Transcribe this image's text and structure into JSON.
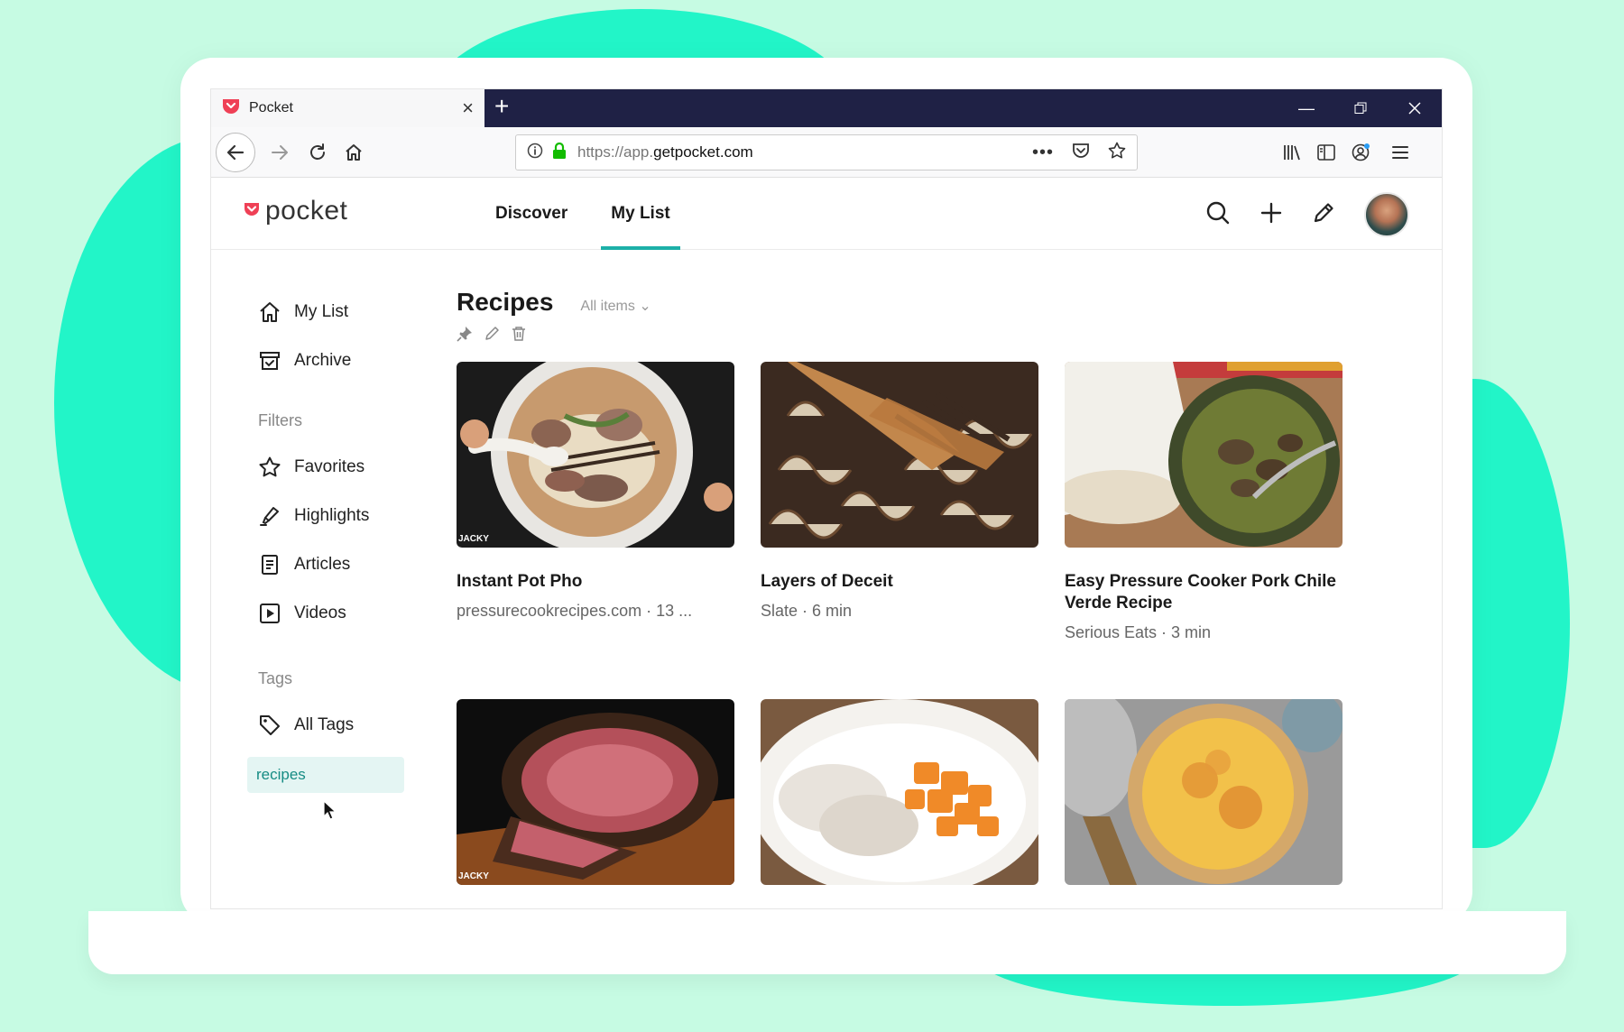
{
  "browser": {
    "tab_title": "Pocket",
    "url_prefix": "https://app.",
    "url_domain": "getpocket.com"
  },
  "app": {
    "logo_text": "pocket",
    "nav": [
      {
        "label": "Discover",
        "active": false
      },
      {
        "label": "My List",
        "active": true
      }
    ],
    "accent_color": "#1cb0a8",
    "brand_color": "#ef4056"
  },
  "sidebar": {
    "primary": [
      {
        "label": "My List",
        "icon": "home-icon"
      },
      {
        "label": "Archive",
        "icon": "archive-icon"
      }
    ],
    "filters_heading": "Filters",
    "filters": [
      {
        "label": "Favorites",
        "icon": "star-icon"
      },
      {
        "label": "Highlights",
        "icon": "highlighter-icon"
      },
      {
        "label": "Articles",
        "icon": "article-icon"
      },
      {
        "label": "Videos",
        "icon": "video-icon"
      }
    ],
    "tags_heading": "Tags",
    "all_tags": "All Tags",
    "active_tag": "recipes"
  },
  "main": {
    "title": "Recipes",
    "filter": "All items",
    "cards": [
      {
        "title": "Instant Pot Pho",
        "meta": "pressurecookrecipes.com · 13 ...",
        "image": "pho-bowl"
      },
      {
        "title": "Layers of Deceit",
        "meta": "Slate · 6 min",
        "image": "caramelized-onions"
      },
      {
        "title": "Easy Pressure Cooker Pork Chile Verde Recipe",
        "meta": "Serious Eats · 3 min",
        "image": "chile-verde"
      },
      {
        "title": "",
        "meta": "",
        "image": "roast-beef"
      },
      {
        "title": "",
        "meta": "",
        "image": "roast-pork-squash"
      },
      {
        "title": "",
        "meta": "",
        "image": "quiche"
      }
    ],
    "image_watermark": "JACKY"
  }
}
